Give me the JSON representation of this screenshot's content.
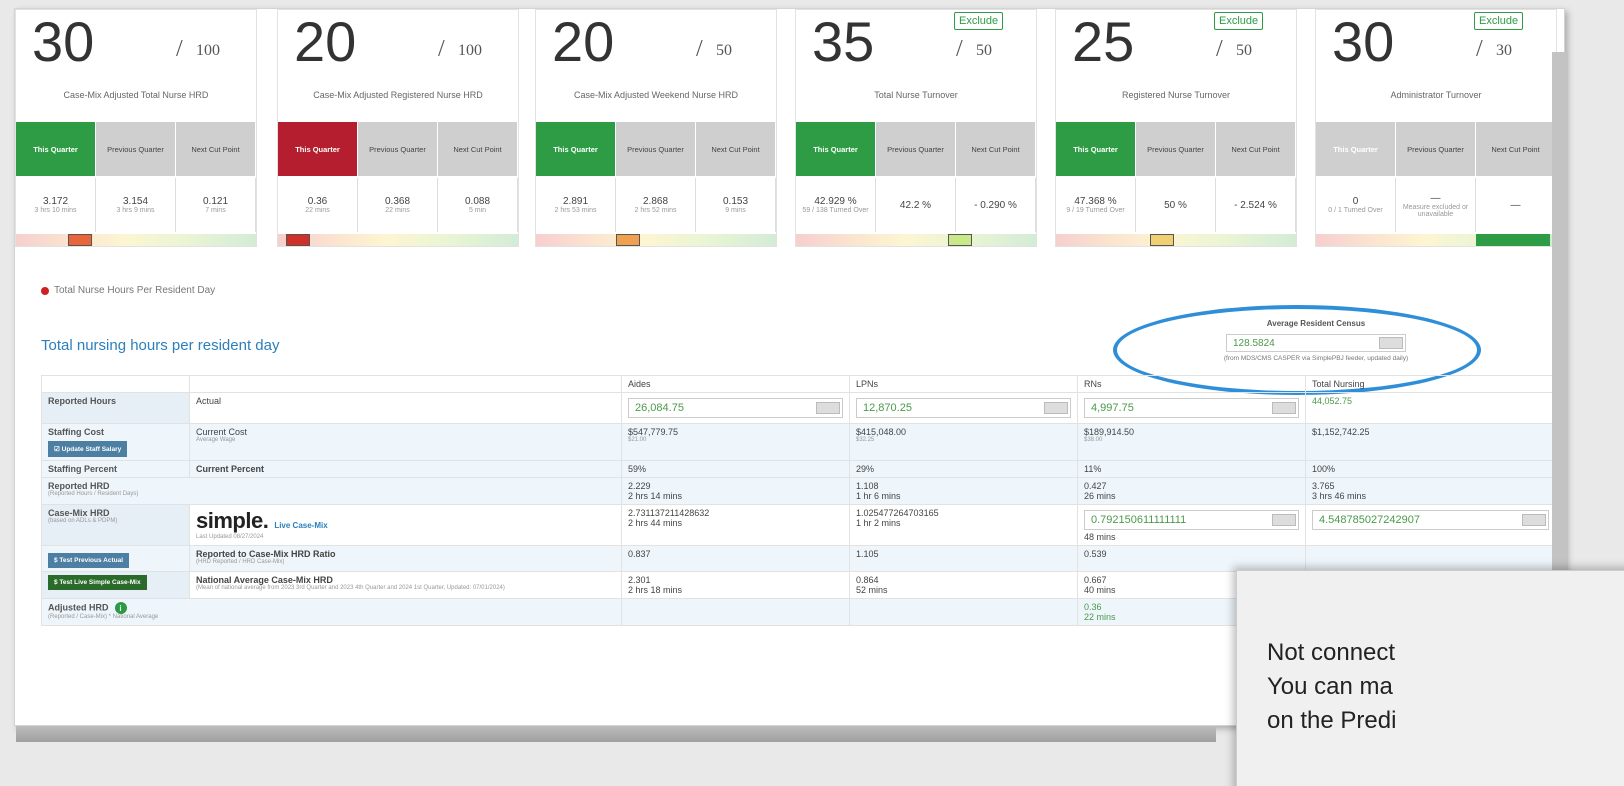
{
  "cards": [
    {
      "score": "30",
      "den": "100",
      "exclude": "",
      "title": "Case-Mix Adjusted Total Nurse HRD",
      "h_cur": "This Quarter",
      "h_prev": "Previous Quarter",
      "h_next": "Next Cut Point",
      "v_cur": "3.172",
      "v_cur_sub": "3 hrs 10 mins",
      "v_prev": "3.154",
      "v_prev_sub": "3 hrs 9 mins",
      "v_next": "0.121",
      "v_next_sub": "7 mins",
      "cur_color": "#2d9c44",
      "mark_color": "#e8663a"
    },
    {
      "score": "20",
      "den": "100",
      "exclude": "",
      "title": "Case-Mix Adjusted Registered Nurse HRD",
      "h_cur": "This Quarter",
      "h_prev": "Previous Quarter",
      "h_next": "Next Cut Point",
      "v_cur": "0.36",
      "v_cur_sub": "22 mins",
      "v_prev": "0.368",
      "v_prev_sub": "22 mins",
      "v_next": "0.088",
      "v_next_sub": "5 min",
      "cur_color": "#b51e2e",
      "mark_color": "#d0302a"
    },
    {
      "score": "20",
      "den": "50",
      "exclude": "",
      "title": "Case-Mix Adjusted Weekend Nurse HRD",
      "h_cur": "This Quarter",
      "h_prev": "Previous Quarter",
      "h_next": "Next Cut Point",
      "v_cur": "2.891",
      "v_cur_sub": "2 hrs 53 mins",
      "v_prev": "2.868",
      "v_prev_sub": "2 hrs 52 mins",
      "v_next": "0.153",
      "v_next_sub": "9 mins",
      "cur_color": "#2d9c44",
      "mark_color": "#f0a050"
    },
    {
      "score": "35",
      "den": "50",
      "exclude": "Exclude",
      "title": "Total Nurse Turnover",
      "h_cur": "This Quarter",
      "h_prev": "Previous Quarter",
      "h_next": "Next Cut Point",
      "v_cur": "42.929 %",
      "v_cur_sub": "59 / 138 Turned Over",
      "v_prev": "42.2 %",
      "v_prev_sub": "",
      "v_next": "- 0.290 %",
      "v_next_sub": "",
      "cur_color": "#2d9c44",
      "mark_color": "#c8e88a"
    },
    {
      "score": "25",
      "den": "50",
      "exclude": "Exclude",
      "title": "Registered Nurse Turnover",
      "h_cur": "This Quarter",
      "h_prev": "Previous Quarter",
      "h_next": "Next Cut Point",
      "v_cur": "47.368 %",
      "v_cur_sub": "9 / 19 Turned Over",
      "v_prev": "50 %",
      "v_prev_sub": "",
      "v_next": "- 2.524 %",
      "v_next_sub": "",
      "cur_color": "#2d9c44",
      "mark_color": "#f0d070"
    },
    {
      "score": "30",
      "den": "30",
      "exclude": "Exclude",
      "title": "Administrator Turnover",
      "h_cur": "This Quarter",
      "h_prev": "Previous Quarter",
      "h_next": "Next Cut Point",
      "v_cur": "0",
      "v_cur_sub": "0 / 1 Turned Over",
      "v_prev": "—",
      "v_prev_sub": "Measure excluded or unavailable",
      "v_next": "—",
      "v_next_sub": "",
      "cur_color": "#cfcfcf",
      "mark_color": "#2d9c44"
    }
  ],
  "section": {
    "label": "Total Nurse Hours Per Resident Day"
  },
  "table_title": "Total nursing hours per resident day",
  "census": {
    "label": "Average Resident Census",
    "value": "128.5824",
    "note": "(from MDS/CMS CASPER via SimplePBJ feeder, updated daily)"
  },
  "cols": {
    "aides": "Aides",
    "lpns": "LPNs",
    "rns": "RNs",
    "total": "Total Nursing"
  },
  "rows": {
    "reported": {
      "label": "Reported Hours",
      "sub": "Actual",
      "aides": "26,084.75",
      "lpns": "12,870.25",
      "rns": "4,997.75",
      "total": "44,052.75"
    },
    "cost": {
      "label": "Staffing Cost",
      "sub": "Current Cost",
      "sub2": "Average Wage",
      "btn": "Update Staff Salary",
      "aides": "$547,779.75",
      "aides2": "$21.00",
      "lpns": "$415,048.00",
      "lpns2": "$32.25",
      "rns": "$189,914.50",
      "rns2": "$38.00",
      "total": "$1,152,742.25"
    },
    "percent": {
      "label": "Staffing Percent",
      "sub": "Current Percent",
      "aides": "59%",
      "lpns": "29%",
      "rns": "11%",
      "total": "100%"
    },
    "hrd": {
      "label": "Reported HRD",
      "sub": "(Reported Hours / Resident Days)",
      "aides": "2.229",
      "aides2": "2 hrs 14 mins",
      "lpns": "1.108",
      "lpns2": "1 hr 6 mins",
      "rns": "0.427",
      "rns2": "26 mins",
      "total": "3.765",
      "total2": "3 hrs 46 mins"
    },
    "casemix": {
      "label": "Case-Mix HRD",
      "sub": "(based on ADLs & PDPM)",
      "logo": "simple.",
      "logo_sub": "Live Case-Mix",
      "logo_note": "Last Updated 08/27/2024",
      "aides": "2.731137211428632",
      "aides2": "2 hrs 44 mins",
      "lpns": "1.025477264703165",
      "lpns2": "1 hr 2 mins",
      "rns": "0.792150611111111",
      "rns2": "48 mins",
      "total": "4.548785027242907"
    },
    "ratio": {
      "btn": "Test Previous Actual",
      "sub": "Reported to Case-Mix HRD Ratio",
      "note": "(HRD Reported / HRD Case-Mix)",
      "aides": "0.837",
      "lpns": "1.105",
      "rns": "0.539"
    },
    "national": {
      "btn": "Test Live Simple Case-Mix",
      "sub": "National Average Case-Mix HRD",
      "note": "(Mean of national average from 2023 3rd Quarter and 2023 4th Quarter and 2024 1st Quarter, Updated: 07/01/2024)",
      "aides": "2.301",
      "aides2": "2 hrs 18 mins",
      "lpns": "0.864",
      "lpns2": "52 mins",
      "rns": "0.667",
      "rns2": "40 mins"
    },
    "adjusted": {
      "label": "Adjusted HRD",
      "sub": "(Reported / Case-Mix) * National Average",
      "rns": "0.36",
      "rns2": "22 mins"
    }
  },
  "popup": {
    "line1": "Not connect",
    "line2": "You can ma",
    "line3": "on the Predi"
  }
}
